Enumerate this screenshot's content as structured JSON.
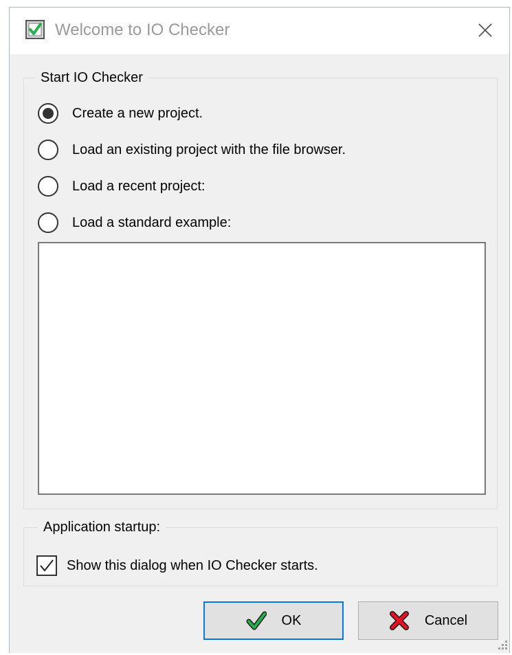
{
  "window": {
    "title": "Welcome to IO Checker"
  },
  "start_group": {
    "legend": "Start IO Checker",
    "options": [
      {
        "label": "Create a new project.",
        "selected": true
      },
      {
        "label": "Load an existing project with the file browser.",
        "selected": false
      },
      {
        "label": "Load a recent project:",
        "selected": false
      },
      {
        "label": "Load a standard example:",
        "selected": false
      }
    ],
    "project_list": []
  },
  "startup_group": {
    "legend": "Application startup:",
    "show_dialog_label": "Show this dialog when IO Checker starts.",
    "show_dialog_checked": true
  },
  "buttons": {
    "ok_label": "OK",
    "cancel_label": "Cancel"
  },
  "icons": {
    "app": "app-check-icon",
    "close": "close-icon",
    "ok": "green-check-icon",
    "cancel": "red-x-icon"
  },
  "colors": {
    "accent": "#0078d7",
    "ok_green": "#22b14c",
    "cancel_red": "#e81123"
  }
}
